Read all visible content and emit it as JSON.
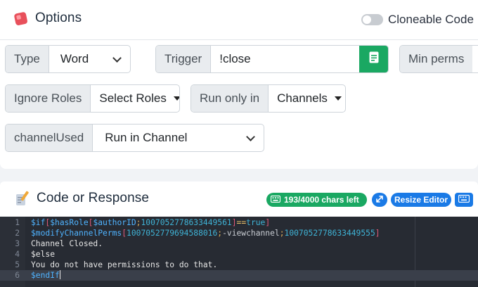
{
  "options_card": {
    "title": "Options",
    "title_icon": "options-cube-icon",
    "cloneable": {
      "label": "Cloneable Code",
      "enabled": false
    }
  },
  "fields": {
    "type": {
      "label": "Type",
      "value": "Word"
    },
    "trigger": {
      "label": "Trigger",
      "value": "!close",
      "button_icon": "document-icon"
    },
    "min_perms": {
      "label": "Min perms"
    },
    "ignore_roles": {
      "label": "Ignore Roles",
      "value": "Select Roles"
    },
    "run_only_in": {
      "label": "Run only in",
      "value": "Channels"
    },
    "channel_used": {
      "label": "channelUsed",
      "value": "Run in Channel"
    }
  },
  "code_card": {
    "title": "Code or Response",
    "title_icon": "pencil-paper-icon",
    "chars_left": "193/4000 chars left",
    "chars_icon": "keyboard-icon",
    "expand_icon": "expand-arrows-icon",
    "resize_label": "Resize Editor",
    "keyboard_icon": "keyboard-icon"
  },
  "editor": {
    "lines": [
      {
        "n": "1",
        "text": "$if[$hasRole[$authorID;1007052778633449561]==true]"
      },
      {
        "n": "2",
        "text": "$modifyChannelPerms[1007052779694588016;-viewchannel;1007052778633449555]"
      },
      {
        "n": "3",
        "text": "Channel Closed."
      },
      {
        "n": "4",
        "text": "$else"
      },
      {
        "n": "5",
        "text": "You do not have permissions to do that."
      },
      {
        "n": "6",
        "text": "$endIf"
      }
    ]
  },
  "colors": {
    "green": "#1aa862",
    "blue": "#1a7ae6",
    "editor_bg": "#272b33",
    "keyword": "#4fb3ff",
    "bracket": "#e05a7a"
  }
}
